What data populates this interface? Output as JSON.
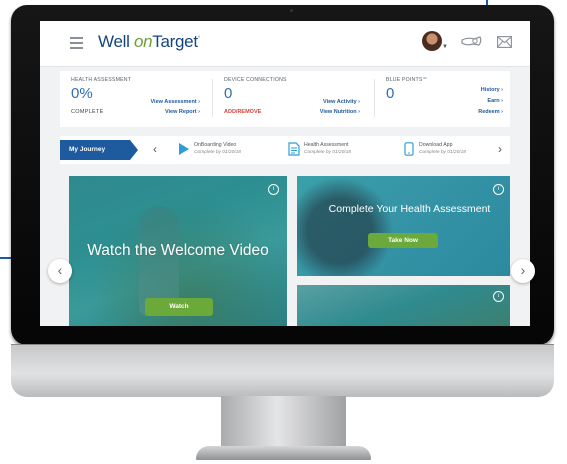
{
  "header": {
    "logo_well": "Well ",
    "logo_on": "on",
    "logo_target": "Target",
    "logo_mark": "°",
    "icons": [
      "menu-icon",
      "avatar",
      "sensor-icon",
      "mail-icon"
    ]
  },
  "stats": {
    "health_assessment": {
      "label": "HEALTH ASSESSMENT",
      "value": "0%",
      "sub": "COMPLETE",
      "link1": "View Assessment ›",
      "link2": "View Report ›"
    },
    "device_connections": {
      "label": "DEVICE CONNECTIONS",
      "value": "0",
      "sub": "ADD/REMOVE",
      "link1": "View Activity ›",
      "link2": "View Nutrition ›"
    },
    "blue_points": {
      "label": "BLUE POINTS℠",
      "value": "0",
      "link1": "History ›",
      "link2": "Earn ›",
      "link3": "Redeem ›"
    }
  },
  "journey": {
    "label": "My Journey",
    "prev": "‹",
    "next": "›",
    "steps": [
      {
        "title": "OnBoarding Video",
        "sub": "Complete by 01/20/18"
      },
      {
        "title": "Health Assessment",
        "sub": "Complete by 01/20/18"
      },
      {
        "title": "Download App",
        "sub": "Complete by 01/20/18"
      }
    ]
  },
  "cards": {
    "welcome": {
      "title": "Watch the Welcome Video",
      "button": "Watch"
    },
    "assessment": {
      "title": "Complete Your Health Assessment",
      "button": "Take Now"
    },
    "info": "i"
  },
  "carousel": {
    "prev": "‹",
    "next": "›"
  },
  "colors": {
    "brand_blue": "#1e5a9e",
    "brand_green": "#6aa93a",
    "link_red": "#d2453a",
    "card_teal": "#2f8a8e"
  }
}
